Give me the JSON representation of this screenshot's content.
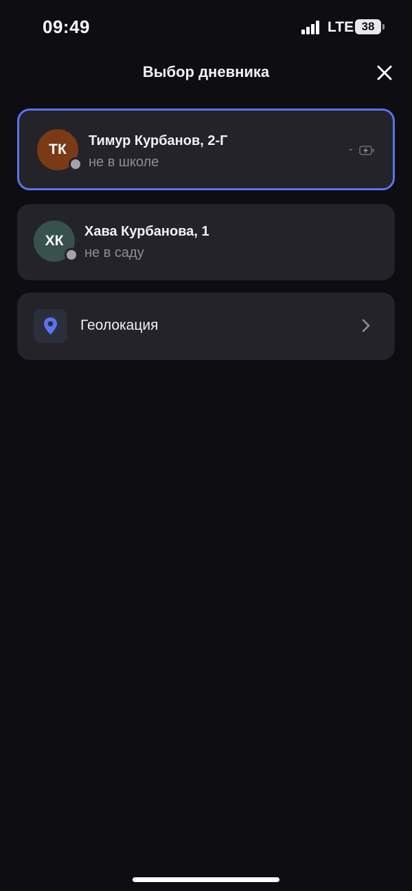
{
  "status_bar": {
    "time": "09:49",
    "network": "LTE",
    "battery": "38"
  },
  "header": {
    "title": "Выбор дневника"
  },
  "children": [
    {
      "initials": "ТК",
      "name": "Тимур Курбанов, 2-Г",
      "status": "не в школе",
      "battery_text": "-",
      "avatar_color": "#7a3a16",
      "selected": true
    },
    {
      "initials": "ХК",
      "name": "Хава Курбанова, 1",
      "status": "не в саду",
      "avatar_color": "#37524d",
      "selected": false
    }
  ],
  "geolocation": {
    "label": "Геолокация",
    "icon": "location-pin-icon"
  },
  "colors": {
    "background": "#0d0d12",
    "card": "#232329",
    "accent": "#5a73f0"
  }
}
